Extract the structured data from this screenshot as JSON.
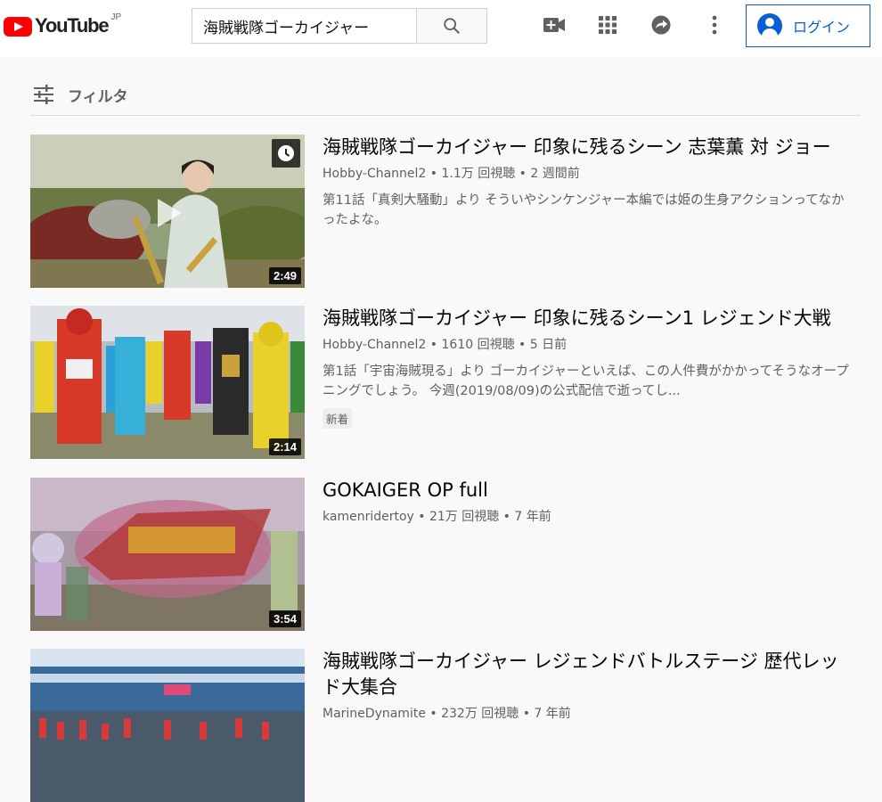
{
  "header": {
    "logo_text": "YouTube",
    "region": "JP",
    "search_value": "海賊戦隊ゴーカイジャー",
    "login_label": "ログイン"
  },
  "filter": {
    "label": "フィルタ"
  },
  "results": [
    {
      "title": "海賊戦隊ゴーカイジャー 印象に残るシーン 志葉薫 対 ジョー",
      "meta": "Hobby-Channel2 • 1.1万 回視聴 • 2 週間前",
      "description": "第11話「真剣大騒動」より そういやシンケンジャー本編では姫の生身アクションってなかったよな。",
      "duration": "2:49"
    },
    {
      "title": "海賊戦隊ゴーカイジャー 印象に残るシーン1 レジェンド大戦",
      "meta": "Hobby-Channel2 • 1610 回視聴 • 5 日前",
      "description": "第1話「宇宙海賊現る」より ゴーカイジャーといえば、この人件費がかかってそうなオープニングでしょう。 今週(2019/08/09)の公式配信で逝ってし...",
      "badge": "新着",
      "duration": "2:14"
    },
    {
      "title": "GOKAIGER OP full",
      "meta": "kamenridertoy • 21万 回視聴 • 7 年前",
      "duration": "3:54"
    },
    {
      "title": "海賊戦隊ゴーカイジャー レジェンドバトルステージ 歴代レッド大集合",
      "meta": "MarineDynamite • 232万 回視聴 • 7 年前"
    }
  ],
  "colors": {
    "brand_red": "#ff0000",
    "link_blue": "#065fd4",
    "background": "#f9f9f9"
  }
}
